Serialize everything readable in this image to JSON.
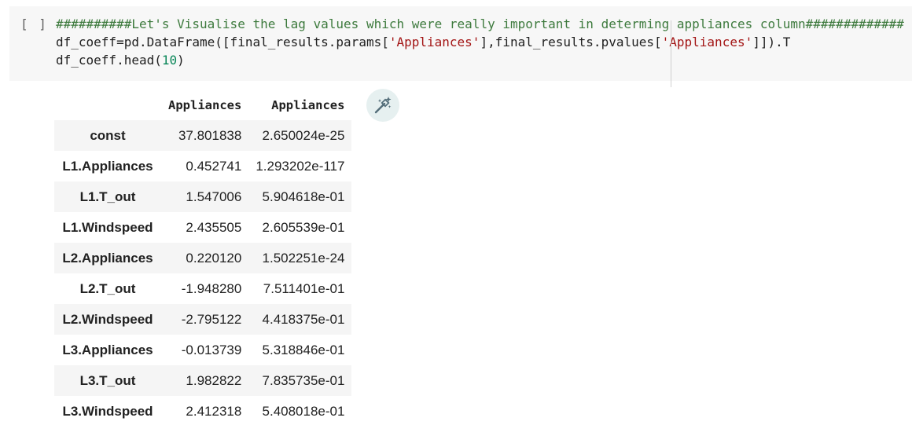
{
  "cell": {
    "run_indicator": "[ ]",
    "code": {
      "line1_comment": "##########Let's Visualise the lag values which were really important in determing appliances column#############",
      "line2_a": "df_coeff=pd.DataFrame([final_results.params[",
      "line2_str1": "'Appliances'",
      "line2_b": "],final_results.pvalues[",
      "line2_str2": "'Appliances'",
      "line2_c": "]]).T",
      "line3_a": "df_coeff.head(",
      "line3_num": "10",
      "line3_b": ")"
    }
  },
  "output": {
    "columns": [
      "",
      "Appliances",
      "Appliances"
    ],
    "rows": [
      {
        "index": "const",
        "v1": "37.801838",
        "v2": "2.650024e-25"
      },
      {
        "index": "L1.Appliances",
        "v1": "0.452741",
        "v2": "1.293202e-117"
      },
      {
        "index": "L1.T_out",
        "v1": "1.547006",
        "v2": "5.904618e-01"
      },
      {
        "index": "L1.Windspeed",
        "v1": "2.435505",
        "v2": "2.605539e-01"
      },
      {
        "index": "L2.Appliances",
        "v1": "0.220120",
        "v2": "1.502251e-24"
      },
      {
        "index": "L2.T_out",
        "v1": "-1.948280",
        "v2": "7.511401e-01"
      },
      {
        "index": "L2.Windspeed",
        "v1": "-2.795122",
        "v2": "4.418375e-01"
      },
      {
        "index": "L3.Appliances",
        "v1": "-0.013739",
        "v2": "5.318846e-01"
      },
      {
        "index": "L3.T_out",
        "v1": "1.982822",
        "v2": "7.835735e-01"
      },
      {
        "index": "L3.Windspeed",
        "v1": "2.412318",
        "v2": "5.408018e-01"
      }
    ]
  },
  "magic_button": {
    "icon": "magic-wand-icon",
    "color": "#546e7a"
  }
}
